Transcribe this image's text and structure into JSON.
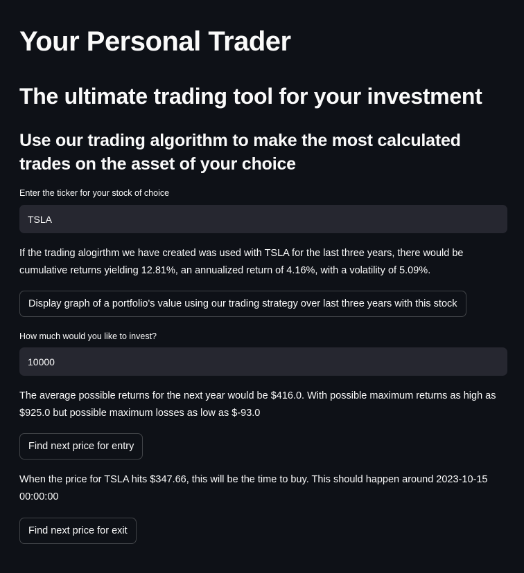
{
  "header": {
    "title": "Your Personal Trader",
    "subtitle": "The ultimate trading tool for your investment",
    "tagline": "Use our trading algorithm to make the most calculated trades on the asset of your choice"
  },
  "ticker": {
    "label": "Enter the ticker for your stock of choice",
    "value": "TSLA"
  },
  "summary": {
    "text": "If the trading alogirthm we have created was used with TSLA for the last three years, there would be cumulative returns yielding 12.81%, an annualized return of 4.16%, with a volatility of 5.09%."
  },
  "graph_button": {
    "label": "Display graph of a portfolio's value using our trading strategy over last three years with this stock"
  },
  "invest": {
    "label": "How much would you like to invest?",
    "value": "10000"
  },
  "returns": {
    "text": "The average possible returns for the next year would be $416.0. With possible maximum returns as high as $925.0 but possible maximum losses as low as $-93.0"
  },
  "entry_button": {
    "label": "Find next price for entry"
  },
  "entry": {
    "text": "When the price for TSLA hits $347.66, this will be the time to buy. This should happen around 2023-10-15 00:00:00"
  },
  "exit_button": {
    "label": "Find next price for exit"
  }
}
